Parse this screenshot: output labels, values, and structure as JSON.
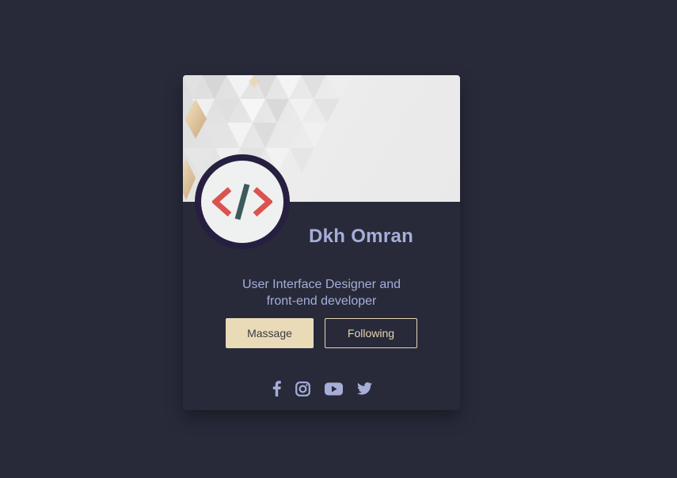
{
  "profile": {
    "name": "Dkh Omran",
    "bio_line1": "User Interface Designer and",
    "bio_line2": "front-end developer",
    "avatar_icon": "code-brackets-icon"
  },
  "actions": {
    "message_label": "Massage",
    "follow_label": "Following"
  },
  "social": {
    "items": [
      "facebook-icon",
      "instagram-icon",
      "youtube-icon",
      "twitter-icon"
    ]
  },
  "colors": {
    "background": "#282a3a",
    "accent": "#e9dbb8",
    "text": "#a6aed8",
    "avatar_ring": "#261f40",
    "code_red": "#d9534f",
    "code_slash": "#3d5a5b"
  }
}
